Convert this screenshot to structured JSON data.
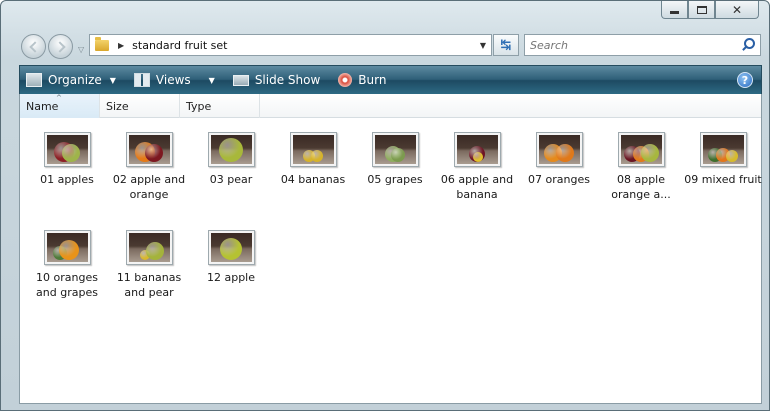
{
  "window": {
    "minimize_icon": "minimize-icon",
    "maximize_icon": "maximize-icon",
    "close_icon": "close-icon",
    "close_glyph": "✕"
  },
  "nav": {
    "back_icon": "back-arrow-icon",
    "forward_icon": "forward-arrow-icon",
    "history_glyph": "▽"
  },
  "address": {
    "path": "standard fruit set",
    "separator": "▶",
    "dropdown_glyph": "▼",
    "refresh_glyph": "↹"
  },
  "search": {
    "placeholder": "Search"
  },
  "toolbar": {
    "organize": "Organize",
    "views": "Views",
    "slideshow": "Slide Show",
    "burn": "Burn",
    "caret": "▼",
    "help": "?"
  },
  "columns": {
    "name": "Name",
    "size": "Size",
    "type": "Type",
    "sort_glyph": "^"
  },
  "files": [
    {
      "label": "01 apples",
      "fruits": [
        [
          "#8d1f25",
          20,
          42
        ],
        [
          "#9fb44a",
          18,
          60
        ]
      ]
    },
    {
      "label": "02 apple and orange",
      "fruits": [
        [
          "#e47a18",
          20,
          40
        ],
        [
          "#7d1820",
          18,
          62
        ]
      ]
    },
    {
      "label": "03 pear",
      "fruits": [
        [
          "#a8b83a",
          24,
          50
        ]
      ]
    },
    {
      "label": "04 bananas",
      "fruits": [
        [
          "#d6b32a",
          12,
          40
        ],
        [
          "#d6b32a",
          12,
          60
        ]
      ]
    },
    {
      "label": "05 grapes",
      "fruits": [
        [
          "#8fae5e",
          16,
          44
        ],
        [
          "#7c9b4e",
          14,
          58
        ]
      ]
    },
    {
      "label": "06 apple and banana",
      "fruits": [
        [
          "#6e1424",
          16,
          50
        ],
        [
          "#e0c12d",
          10,
          52
        ]
      ]
    },
    {
      "label": "07 oranges",
      "fruits": [
        [
          "#e58a1c",
          18,
          36
        ],
        [
          "#e0791a",
          18,
          64
        ]
      ]
    },
    {
      "label": "08 apple orange a...",
      "fruits": [
        [
          "#6a1522",
          16,
          28
        ],
        [
          "#e27a1b",
          16,
          50
        ],
        [
          "#a7b73f",
          18,
          72
        ]
      ]
    },
    {
      "label": "09 mixed fruit",
      "fruits": [
        [
          "#3f6f2d",
          14,
          30
        ],
        [
          "#e3761a",
          14,
          50
        ],
        [
          "#d7bb2c",
          12,
          72
        ]
      ]
    },
    {
      "label": "10 oranges and grapes",
      "fruits": [
        [
          "#4e7b3a",
          14,
          34
        ],
        [
          "#e8931a",
          20,
          56
        ]
      ]
    },
    {
      "label": "11 bananas and pear",
      "fruits": [
        [
          "#d9b82d",
          10,
          40
        ],
        [
          "#a4b33b",
          18,
          64
        ]
      ]
    },
    {
      "label": "12 apple",
      "fruits": [
        [
          "#b5c232",
          22,
          50
        ]
      ]
    }
  ]
}
